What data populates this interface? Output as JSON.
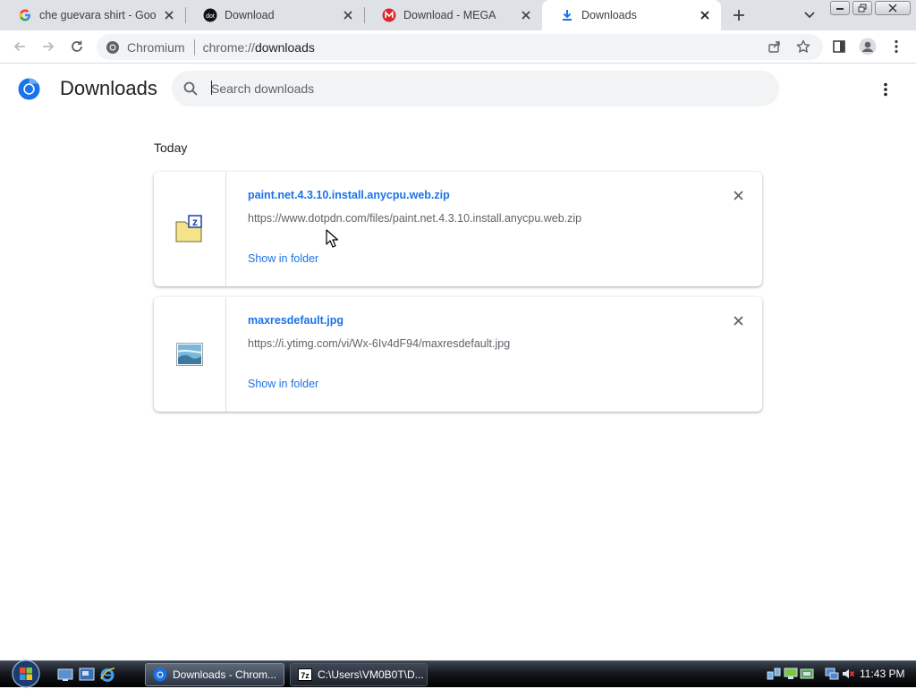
{
  "tabs": [
    {
      "title": "che guevara shirt - Google Search",
      "icon": "google-icon",
      "active": false
    },
    {
      "title": "Download",
      "icon": "dotpdn-icon",
      "active": false
    },
    {
      "title": "Download - MEGA",
      "icon": "mega-icon",
      "active": false
    },
    {
      "title": "Downloads",
      "icon": "download-icon",
      "active": true
    }
  ],
  "omnibox": {
    "site_label": "Chromium",
    "url_scheme": "chrome://",
    "url_host": "downloads"
  },
  "page": {
    "title": "Downloads",
    "search_placeholder": "Search downloads",
    "date_heading": "Today"
  },
  "downloads": [
    {
      "filename": "paint.net.4.3.10.install.anycpu.web.zip",
      "url": "https://www.dotpdn.com/files/paint.net.4.3.10.install.anycpu.web.zip",
      "action": "Show in folder",
      "icon": "zip-archive-icon"
    },
    {
      "filename": "maxresdefault.jpg",
      "url": "https://i.ytimg.com/vi/Wx-6Iv4dF94/maxresdefault.jpg",
      "action": "Show in folder",
      "icon": "image-file-icon"
    }
  ],
  "taskbar": {
    "tasks": [
      {
        "label": "Downloads - Chrom...",
        "icon": "chromium-icon",
        "active": true
      },
      {
        "label": "C:\\Users\\VM0B0T\\D...",
        "icon": "7zip-icon",
        "active": false
      }
    ],
    "clock": "11:43 PM"
  },
  "colors": {
    "accent": "#1a73e8",
    "tabstrip": "#dee1e6",
    "omnibox": "#f1f3f4"
  }
}
